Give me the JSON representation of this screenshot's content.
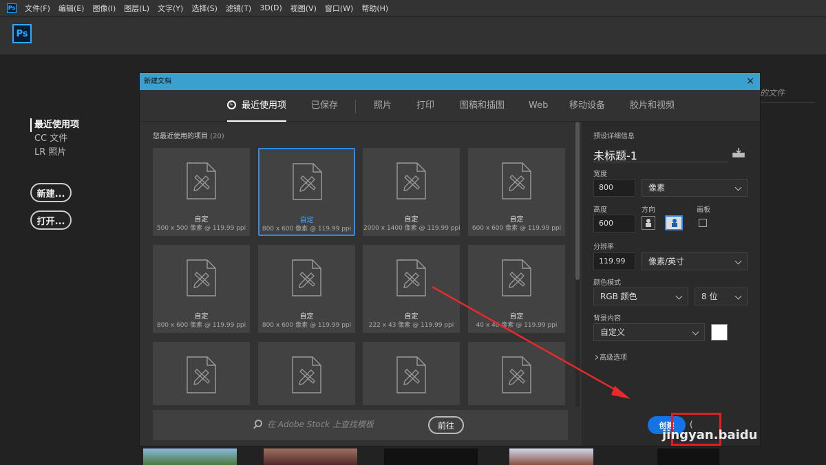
{
  "menubar": {
    "app_icon": "Ps",
    "items": [
      "文件(F)",
      "编辑(E)",
      "图像(I)",
      "图层(L)",
      "文字(Y)",
      "选择(S)",
      "滤镜(T)",
      "3D(D)",
      "视图(V)",
      "窗口(W)",
      "帮助(H)"
    ]
  },
  "home": {
    "logo": "Ps",
    "nav": [
      "最近使用项",
      "CC 文件",
      "LR 照片"
    ],
    "new_button": "新建...",
    "open_button": "打开...",
    "right_text": "的文件"
  },
  "dialog": {
    "title": "新建文档",
    "close": "×",
    "tabs": [
      "最近使用项",
      "已保存",
      "照片",
      "打印",
      "图稿和插图",
      "Web",
      "移动设备",
      "胶片和视频"
    ],
    "recent_title": "您最近使用的项目",
    "recent_count": "(20)",
    "cards": [
      {
        "name": "自定",
        "size": "500 x 500 像素 @ 119.99 ppi"
      },
      {
        "name": "自定",
        "size": "800 x 600 像素 @ 119.99 ppi"
      },
      {
        "name": "自定",
        "size": "2000 x 1400 像素 @ 119.99 ppi"
      },
      {
        "name": "自定",
        "size": "600 x 600 像素 @ 119.99 ppi"
      },
      {
        "name": "自定",
        "size": "800 x 600 像素 @ 119.99 ppi"
      },
      {
        "name": "自定",
        "size": "800 x 600 像素 @ 119.99 ppi"
      },
      {
        "name": "自定",
        "size": "222 x 43 像素 @ 119.99 ppi"
      },
      {
        "name": "自定",
        "size": "40 x 40 像素 @ 119.99 ppi"
      },
      {
        "name": "",
        "size": ""
      },
      {
        "name": "",
        "size": ""
      },
      {
        "name": "",
        "size": ""
      },
      {
        "name": "",
        "size": ""
      }
    ],
    "stock_placeholder": "在 Adobe Stock 上查找模板",
    "go_button": "前往",
    "details": {
      "section": "预设详细信息",
      "doc_name": "未标题-1",
      "width_label": "宽度",
      "width_value": "800",
      "width_unit": "像素",
      "height_label": "高度",
      "height_value": "600",
      "orientation_label": "方向",
      "artboard_label": "画板",
      "resolution_label": "分辨率",
      "resolution_value": "119.99",
      "resolution_unit": "像素/英寸",
      "color_mode_label": "颜色模式",
      "color_mode": "RGB 颜色",
      "bit_depth": "8 位",
      "background_label": "背景内容",
      "background": "自定义",
      "background_color": "#ffffff",
      "advanced": "高级选项",
      "create_button": "创建",
      "close_button": "关闭"
    }
  },
  "watermark": "jingyan.baidu",
  "colors": {
    "accent": "#1473e6",
    "title_bar": "#3aa0d0",
    "highlight": "#e02020",
    "selected_border": "#2d8ceb"
  }
}
